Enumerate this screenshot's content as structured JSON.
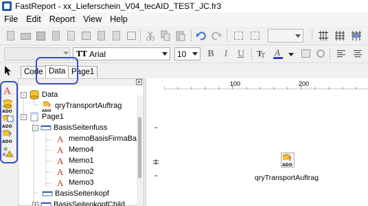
{
  "window": {
    "title": "FastReport - xx_Lieferschein_V04_tecAID_TEST_JC.fr3"
  },
  "menu": {
    "items": [
      "File",
      "Edit",
      "Report",
      "View",
      "Help"
    ]
  },
  "format_toolbar": {
    "style_value": "",
    "font_name": "Arial",
    "font_size": "10",
    "bold_label": "B",
    "italic_label": "I",
    "underline_label": "U",
    "font_color": "#2a3fc7"
  },
  "tabs": {
    "items": [
      {
        "label": "Code",
        "active": false
      },
      {
        "label": "Data",
        "active": true
      },
      {
        "label": "Page1",
        "active": false
      }
    ]
  },
  "tree": {
    "nodes": [
      {
        "label": "Data",
        "icon": "data-cylinder-icon",
        "expander": "-"
      },
      {
        "label": "qryTransportAuftrag",
        "icon": "ado-query-icon"
      },
      {
        "label": "Page1",
        "icon": "page-icon",
        "expander": "-"
      },
      {
        "label": "BasisSeitenfuss",
        "icon": "band-icon",
        "expander": "-"
      },
      {
        "label": "memoBasisFirmaBa",
        "icon": "memo-icon"
      },
      {
        "label": "Memo4",
        "icon": "memo-icon"
      },
      {
        "label": "Memo1",
        "icon": "memo-icon"
      },
      {
        "label": "Memo2",
        "icon": "memo-icon"
      },
      {
        "label": "Memo3",
        "icon": "memo-icon"
      },
      {
        "label": "BasisSeitenkopf",
        "icon": "band-icon"
      },
      {
        "label": "BasisSeitenkopfChild",
        "icon": "band-icon",
        "expander": "+"
      }
    ]
  },
  "ruler": {
    "top_labels": [
      "100",
      "200"
    ]
  },
  "canvas": {
    "component_label": "qryTransportAuftrag",
    "component_icon": "ado-query-icon"
  },
  "colors": {
    "highlight": "#3a4fc4",
    "tree_icon_red": "#c0392b",
    "band_blue": "#3d6fb8"
  }
}
